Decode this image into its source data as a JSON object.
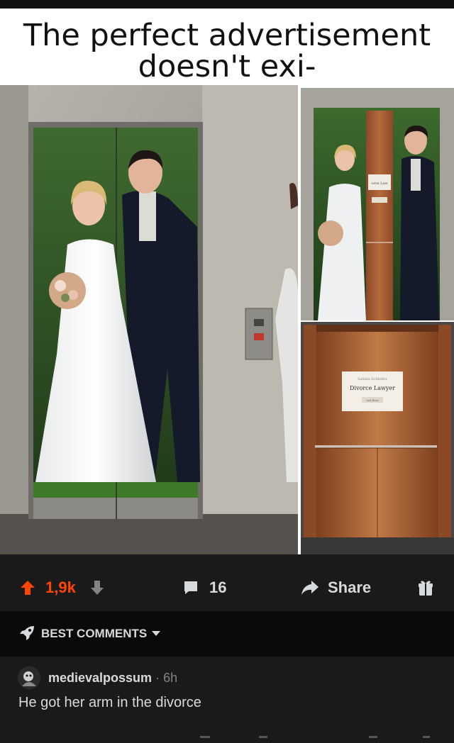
{
  "post": {
    "caption_line1": "The perfect advertisement",
    "caption_line2": "doesn't exi-",
    "ad_sign_small_name": "Sabina Schleifer",
    "ad_sign_title": "Divorce Lawyer",
    "ad_sign_floor": "3rd floor",
    "ad_sign_title_cropped": "orce Law"
  },
  "actions": {
    "upvotes": "1,9k",
    "comments_count": "16",
    "share_label": "Share"
  },
  "comments_section": {
    "sort_label": "BEST COMMENTS"
  },
  "comment": {
    "username": "medievalpossum",
    "separator": "·",
    "time": "6h",
    "body": "He got her arm in the divorce"
  },
  "colors": {
    "upvote_active": "#ff4500",
    "background": "#1a1a1b",
    "text": "#d7dadc"
  },
  "icons": [
    "upvote-arrow-icon",
    "downvote-arrow-icon",
    "comment-bubble-icon",
    "share-arrow-icon",
    "award-gift-icon",
    "rocket-icon",
    "dropdown-caret-icon"
  ]
}
